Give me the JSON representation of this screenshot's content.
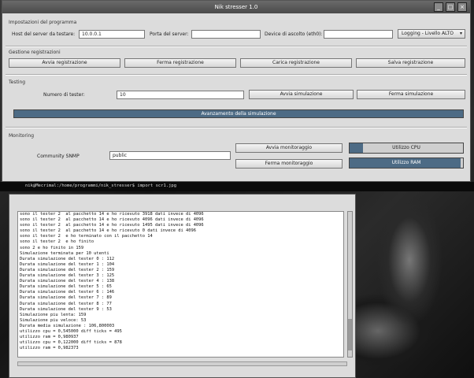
{
  "window": {
    "title": "Nik stresser 1.0"
  },
  "settings": {
    "section_label": "Impostazioni del programma",
    "host_label": "Host del server da testare:",
    "host_value": "10.0.0.1",
    "port_label": "Porta del server:",
    "port_value": "",
    "device_label": "Device di ascolto (eth0):",
    "device_value": "",
    "logging_value": "Logging - Livello ALTO"
  },
  "recording": {
    "section_label": "Gestione registrazioni",
    "start": "Avvia registrazione",
    "stop": "Ferma registrazione",
    "load": "Carica registrazione",
    "save": "Salva registrazione"
  },
  "testing": {
    "section_label": "Testing",
    "testers_label": "Numero di tester:",
    "testers_value": "10",
    "start": "Avvia simulazione",
    "stop": "Ferma simulazione",
    "progress_label": "Avanzamento della simulazione",
    "progress_value": 1.0
  },
  "monitoring": {
    "section_label": "Monitoring",
    "community_label": "Community SNMP",
    "community_value": "public",
    "start": "Avvia monitoraggio",
    "stop": "Ferma monitoraggio",
    "cpu_label": "Utilizzo CPU",
    "cpu_value": 0.12,
    "ram_label": "Utilizzo RAM",
    "ram_value": 0.98
  },
  "terminal": {
    "prompt": "nik@Mecrimal:/home/programmi/nik_stresser$ import scr1.jpg",
    "lines": [
      "sono il tester 2  al pacchetto 14 e ho ricevuto 3918 dati invece di 4096",
      "sono il tester 2  al pacchetto 14 e ho ricevuto 4096 dati invece di 4096",
      "sono il tester 2  al pacchetto 14 e ho ricevuto 1495 dati invece di 4096",
      "sono il tester 2  al pacchetto 14 e ho ricevuto 0 dati invece di 4096",
      "sono il tester 2  e ho terminato con il pacchetto 14",
      "sono il tester 2  e ho finito",
      "sono 2 e ho finito in 159",
      "Simulazione terminata per 10 utenti",
      "Durata simulazione del tester 0 : 112",
      "Durata simulazione del tester 1 : 104",
      "Durata simulazione del tester 2 : 159",
      "Durata simulazione del tester 3 : 125",
      "Durata simulazione del tester 4 : 138",
      "Durata simulazione del tester 5 : 65",
      "Durata simulazione del tester 6 : 146",
      "Durata simulazione del tester 7 : 89",
      "Durata simulazione del tester 8 : 77",
      "Durata simulazione del tester 9 : 53",
      "Simulazione piu lenta: 159",
      "Simulazione piu veloce: 53",
      "Durata media simulazione : 106,800003",
      "utilizzo cpu = 0,545000 diff ticks = 495",
      "utilizzo ram = 0,980937",
      "utilizzo cpu = 0,122000 diff ticks = 878",
      "utilizzo ram = 0,982373"
    ]
  }
}
